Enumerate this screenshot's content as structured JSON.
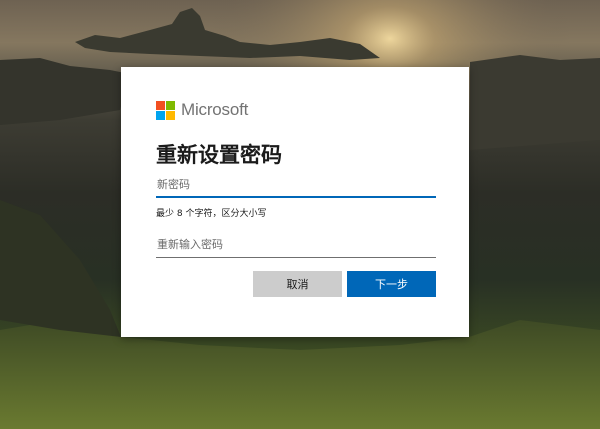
{
  "brand": {
    "name": "Microsoft",
    "logo_colors": [
      "#f25022",
      "#7fba00",
      "#00a4ef",
      "#ffb900"
    ]
  },
  "dialog": {
    "title": "重新设置密码",
    "new_password": {
      "placeholder": "新密码",
      "value": ""
    },
    "hint": "最少 8 个字符，区分大小写",
    "confirm_password": {
      "placeholder": "重新输入密码",
      "value": ""
    },
    "buttons": {
      "cancel": "取消",
      "next": "下一步"
    }
  },
  "colors": {
    "accent": "#0067b8",
    "cancel_bg": "#cccccc"
  }
}
